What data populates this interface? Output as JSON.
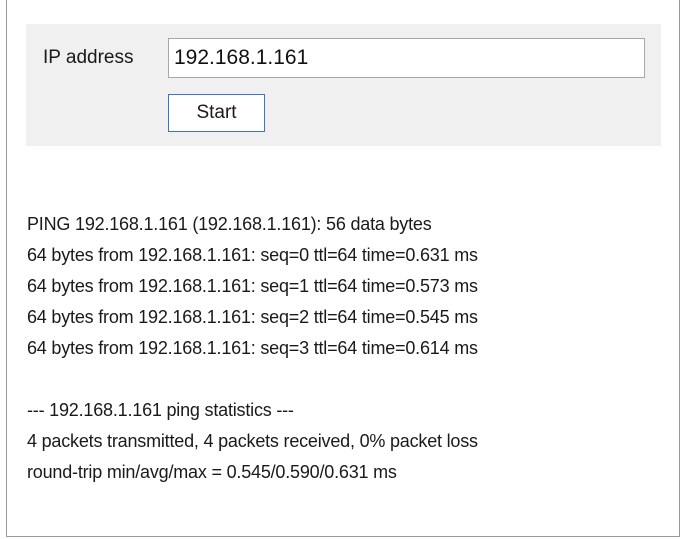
{
  "form": {
    "ip_label": "IP address",
    "ip_value": "192.168.1.161",
    "start_label": "Start"
  },
  "output": {
    "header": "PING 192.168.1.161 (192.168.1.161): 56 data bytes",
    "replies": [
      "64 bytes from 192.168.1.161: seq=0 ttl=64 time=0.631 ms",
      "64 bytes from 192.168.1.161: seq=1 ttl=64 time=0.573 ms",
      "64 bytes from 192.168.1.161: seq=2 ttl=64 time=0.545 ms",
      "64 bytes from 192.168.1.161: seq=3 ttl=64 time=0.614 ms"
    ],
    "stats_header": "--- 192.168.1.161 ping statistics ---",
    "packets": "4 packets transmitted, 4 packets received, 0% packet loss",
    "round_trip": "round-trip min/avg/max = 0.545/0.590/0.631 ms"
  },
  "colors": {
    "panel_border": "#9a9a9a",
    "form_background": "#f0f0f0",
    "button_border": "#3a73c8",
    "text": "#1a1a1a"
  }
}
